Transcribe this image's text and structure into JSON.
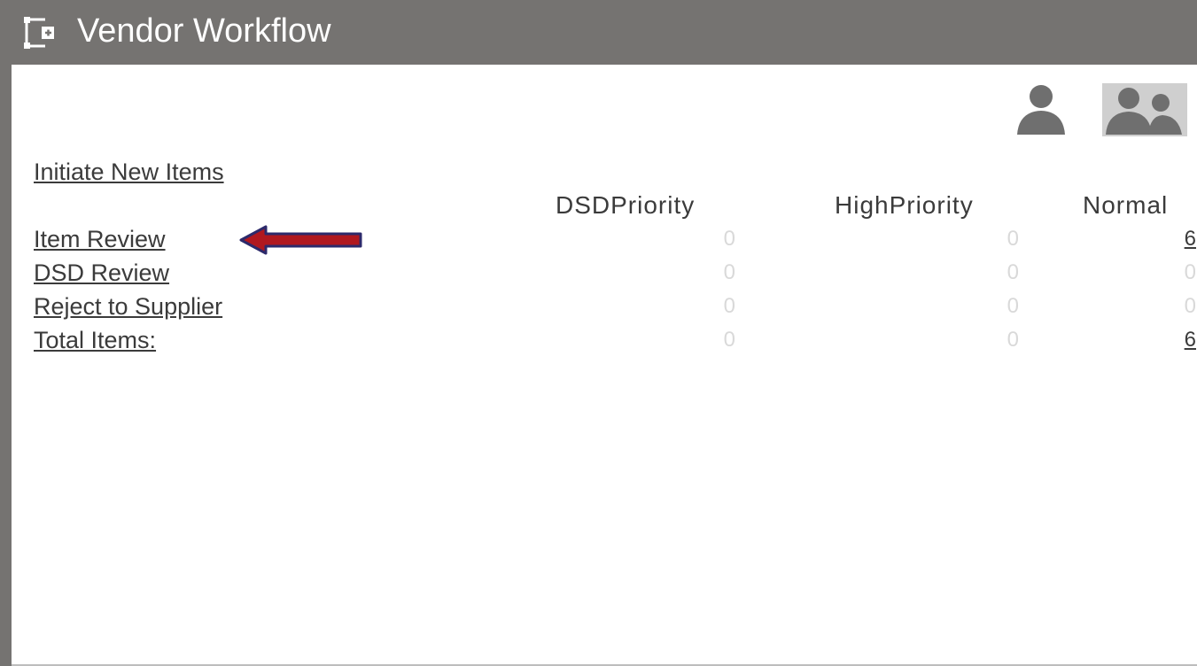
{
  "header": {
    "title": "Vendor Workflow",
    "icon": "workflow-icon"
  },
  "toolbar": {
    "user_icon": "user-icon",
    "group_icon": "group-icon"
  },
  "links": {
    "initiate": "Initiate New Items"
  },
  "table": {
    "columns": [
      "DSDPriority",
      "HighPriority",
      "Normal"
    ],
    "rows": [
      {
        "label": "Item Review",
        "values": [
          "0",
          "0",
          "6"
        ]
      },
      {
        "label": "DSD Review",
        "values": [
          "0",
          "0",
          "0"
        ]
      },
      {
        "label": "Reject to Supplier",
        "values": [
          "0",
          "0",
          "0"
        ]
      },
      {
        "label": "Total Items:",
        "values": [
          "0",
          "0",
          "6"
        ]
      }
    ]
  },
  "annotation": {
    "icon": "arrow-left-icon",
    "color": "#b0181f",
    "outline": "#2d2a6b"
  }
}
